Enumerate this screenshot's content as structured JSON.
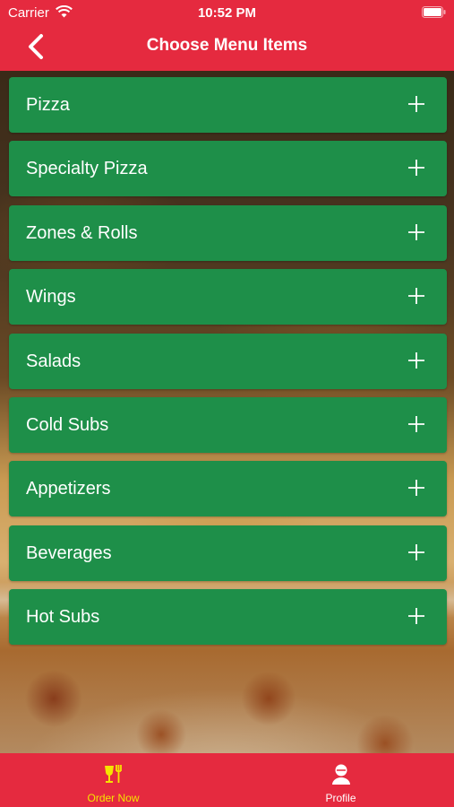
{
  "status_bar": {
    "carrier": "Carrier",
    "time": "10:52 PM"
  },
  "nav": {
    "title": "Choose Menu Items"
  },
  "menu": {
    "items": [
      {
        "label": "Pizza"
      },
      {
        "label": "Specialty Pizza"
      },
      {
        "label": "Zones & Rolls"
      },
      {
        "label": "Wings"
      },
      {
        "label": "Salads"
      },
      {
        "label": "Cold Subs"
      },
      {
        "label": "Appetizers"
      },
      {
        "label": "Beverages"
      },
      {
        "label": "Hot Subs"
      }
    ]
  },
  "tabs": {
    "order_now": {
      "label": "Order Now",
      "icon": "food-icon",
      "color": "#f5e400"
    },
    "profile": {
      "label": "Profile",
      "icon": "user-icon",
      "color": "#ffffff"
    }
  },
  "colors": {
    "primary": "#e52a3f",
    "menu_item": "#1e8f49"
  }
}
